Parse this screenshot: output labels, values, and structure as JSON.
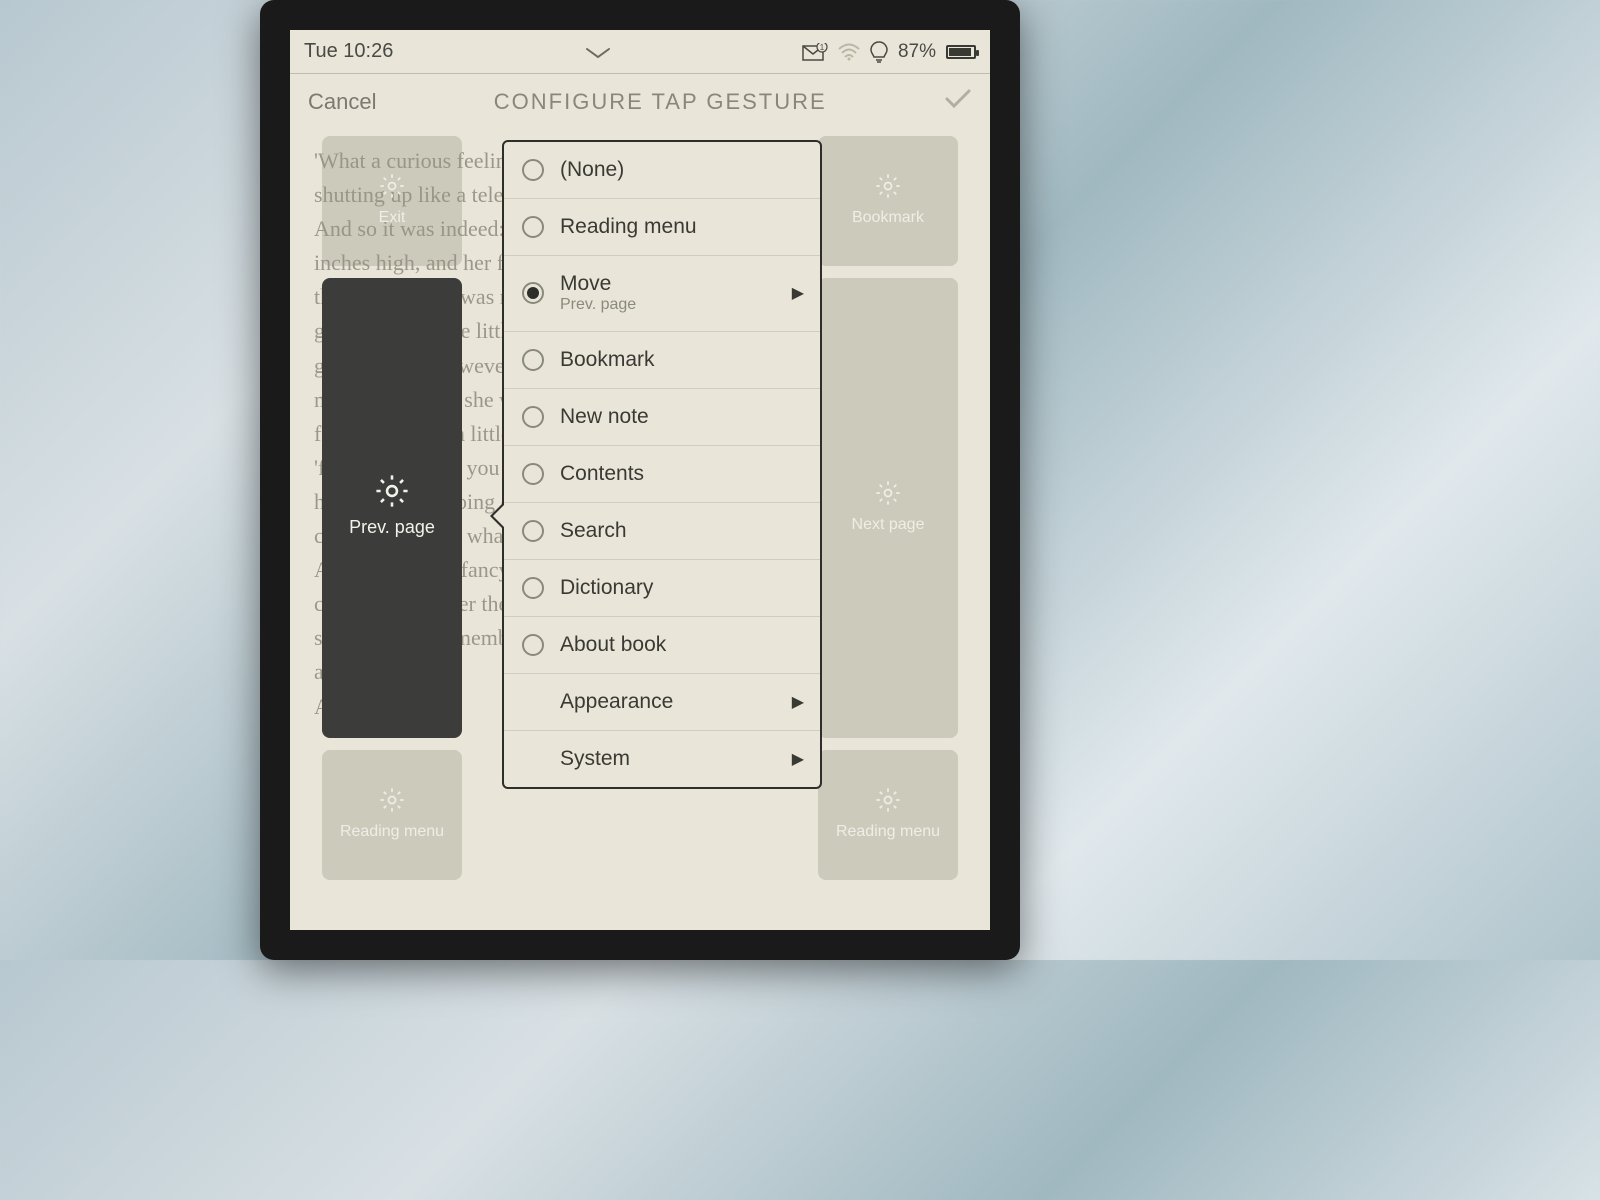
{
  "status": {
    "time": "Tue 10:26",
    "battery_pct": "87%",
    "notif_badge": "1"
  },
  "header": {
    "cancel": "Cancel",
    "title": "CONFIGURE TAP GESTURE"
  },
  "zones": {
    "exit": "Exit",
    "bookmark": "Bookmark",
    "prev": "Prev. page",
    "next": "Next page",
    "reading_menu": "Reading menu"
  },
  "ghost": "'What a curious feeling!' said Alice; 'I must be\nshutting up like a telescope.'\nAnd so it was indeed: she was now only ten\ninches high, and her face brightened up at the\nthought that she was now the right size for\ngoing through the little door into that lovely\ngarden. First, however, she waited for a few\nminutes to see if she was going to shrink any\nfurther: she felt a little nervous about this;\n'for it might end, you know,' said Alice to\nherself, 'in my going out altogether, like a\ncandle. I wonder what I should be like then?'\nAnd she tried to fancy what the flame of a\ncandle is like after the candle is blown out, for\nshe could not remember ever having seen such\na thing.\nAfter a while,",
  "menu": {
    "items": [
      {
        "label": "(None)",
        "type": "radio",
        "checked": false
      },
      {
        "label": "Reading menu",
        "type": "radio",
        "checked": false
      },
      {
        "label": "Move",
        "type": "radio",
        "checked": true,
        "sub": "Prev. page",
        "submenu": true
      },
      {
        "label": "Bookmark",
        "type": "radio",
        "checked": false
      },
      {
        "label": "New note",
        "type": "radio",
        "checked": false
      },
      {
        "label": "Contents",
        "type": "radio",
        "checked": false
      },
      {
        "label": "Search",
        "type": "radio",
        "checked": false
      },
      {
        "label": "Dictionary",
        "type": "radio",
        "checked": false
      },
      {
        "label": "About book",
        "type": "radio",
        "checked": false
      },
      {
        "label": "Appearance",
        "type": "submenu"
      },
      {
        "label": "System",
        "type": "submenu"
      }
    ]
  }
}
